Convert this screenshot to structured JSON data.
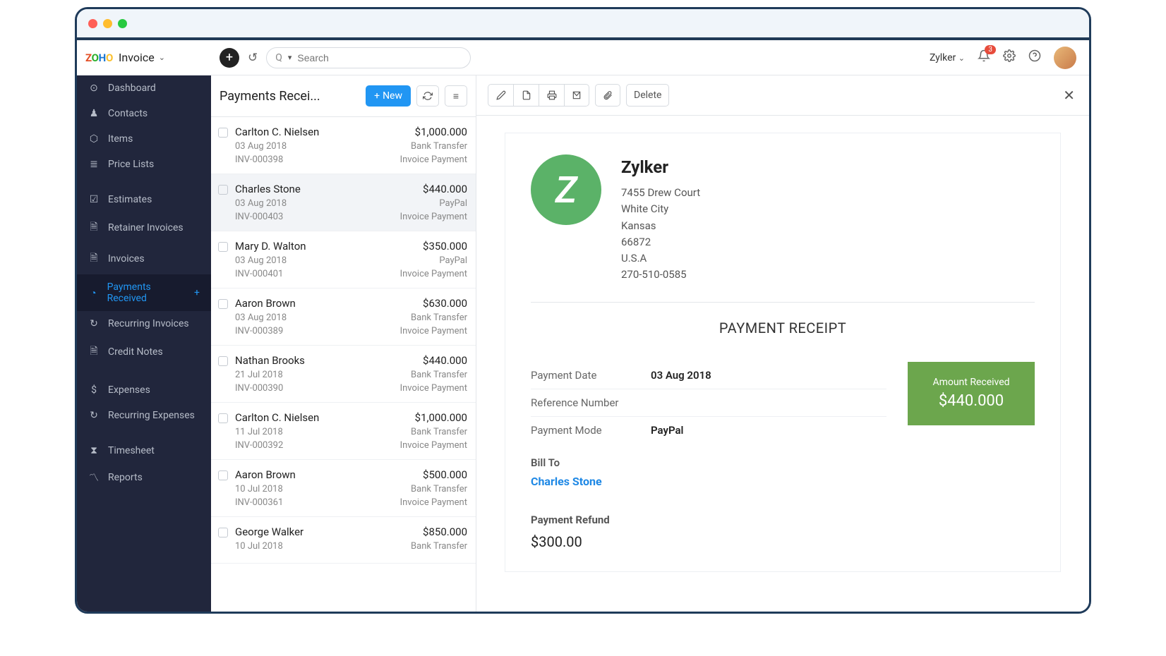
{
  "app": {
    "name": "Invoice"
  },
  "topbar": {
    "search_placeholder": "Search",
    "org_name": "Zylker",
    "notification_count": "3"
  },
  "sidebar": {
    "items": [
      {
        "icon": "⊙",
        "label": "Dashboard"
      },
      {
        "icon": "♟",
        "label": "Contacts"
      },
      {
        "icon": "⬡",
        "label": "Items"
      },
      {
        "icon": "≣",
        "label": "Price Lists"
      }
    ],
    "items2": [
      {
        "icon": "☑",
        "label": "Estimates"
      },
      {
        "icon": "🗎",
        "label": "Retainer Invoices"
      },
      {
        "icon": "🗎",
        "label": "Invoices"
      },
      {
        "icon": "◔",
        "label": "Payments Received",
        "active": true,
        "add": true
      },
      {
        "icon": "↻",
        "label": "Recurring Invoices"
      },
      {
        "icon": "🗎",
        "label": "Credit Notes"
      }
    ],
    "items3": [
      {
        "icon": "$",
        "label": "Expenses"
      },
      {
        "icon": "↻",
        "label": "Recurring Expenses"
      }
    ],
    "items4": [
      {
        "icon": "⧗",
        "label": "Timesheet"
      },
      {
        "icon": "〽",
        "label": "Reports"
      }
    ]
  },
  "list": {
    "title": "Payments Recei...",
    "new_label": "New",
    "payments": [
      {
        "name": "Carlton C. Nielsen",
        "date": "03 Aug 2018",
        "invoice": "INV-000398",
        "amount": "$1,000.000",
        "mode": "Bank Transfer",
        "type": "Invoice Payment"
      },
      {
        "name": "Charles Stone",
        "date": "03 Aug 2018",
        "invoice": "INV-000403",
        "amount": "$440.000",
        "mode": "PayPal",
        "type": "Invoice Payment",
        "selected": true
      },
      {
        "name": "Mary D. Walton",
        "date": "03 Aug 2018",
        "invoice": "INV-000401",
        "amount": "$350.000",
        "mode": "PayPal",
        "type": "Invoice Payment"
      },
      {
        "name": "Aaron Brown",
        "date": "03 Aug 2018",
        "invoice": "INV-000389",
        "amount": "$630.000",
        "mode": "Bank Transfer",
        "type": "Invoice Payment"
      },
      {
        "name": "Nathan Brooks",
        "date": "21 Jul 2018",
        "invoice": "INV-000390",
        "amount": "$440.000",
        "mode": "Bank Transfer",
        "type": "Invoice Payment"
      },
      {
        "name": "Carlton C. Nielsen",
        "date": "11 Jul 2018",
        "invoice": "INV-000392",
        "amount": "$1,000.000",
        "mode": "Bank Transfer",
        "type": "Invoice Payment"
      },
      {
        "name": "Aaron Brown",
        "date": "10 Jul 2018",
        "invoice": "INV-000361",
        "amount": "$500.000",
        "mode": "Bank Transfer",
        "type": "Invoice Payment"
      },
      {
        "name": "George Walker",
        "date": "10 Jul 2018",
        "invoice": "",
        "amount": "$850.000",
        "mode": "Bank Transfer",
        "type": ""
      }
    ]
  },
  "detail": {
    "delete_label": "Delete",
    "company": {
      "name": "Zylker",
      "logo_letter": "Z",
      "street": "7455 Drew Court",
      "city": "White City",
      "state": "Kansas",
      "zip": "66872",
      "country": "U.S.A",
      "phone": "270-510-0585"
    },
    "receipt_title": "PAYMENT RECEIPT",
    "fields": {
      "payment_date_label": "Payment Date",
      "payment_date_value": "03 Aug 2018",
      "reference_label": "Reference Number",
      "reference_value": "",
      "payment_mode_label": "Payment Mode",
      "payment_mode_value": "PayPal"
    },
    "amount_box": {
      "label": "Amount Received",
      "value": "$440.000"
    },
    "bill_to": {
      "label": "Bill To",
      "name": "Charles Stone"
    },
    "refund": {
      "label": "Payment Refund",
      "value": "$300.00"
    }
  }
}
